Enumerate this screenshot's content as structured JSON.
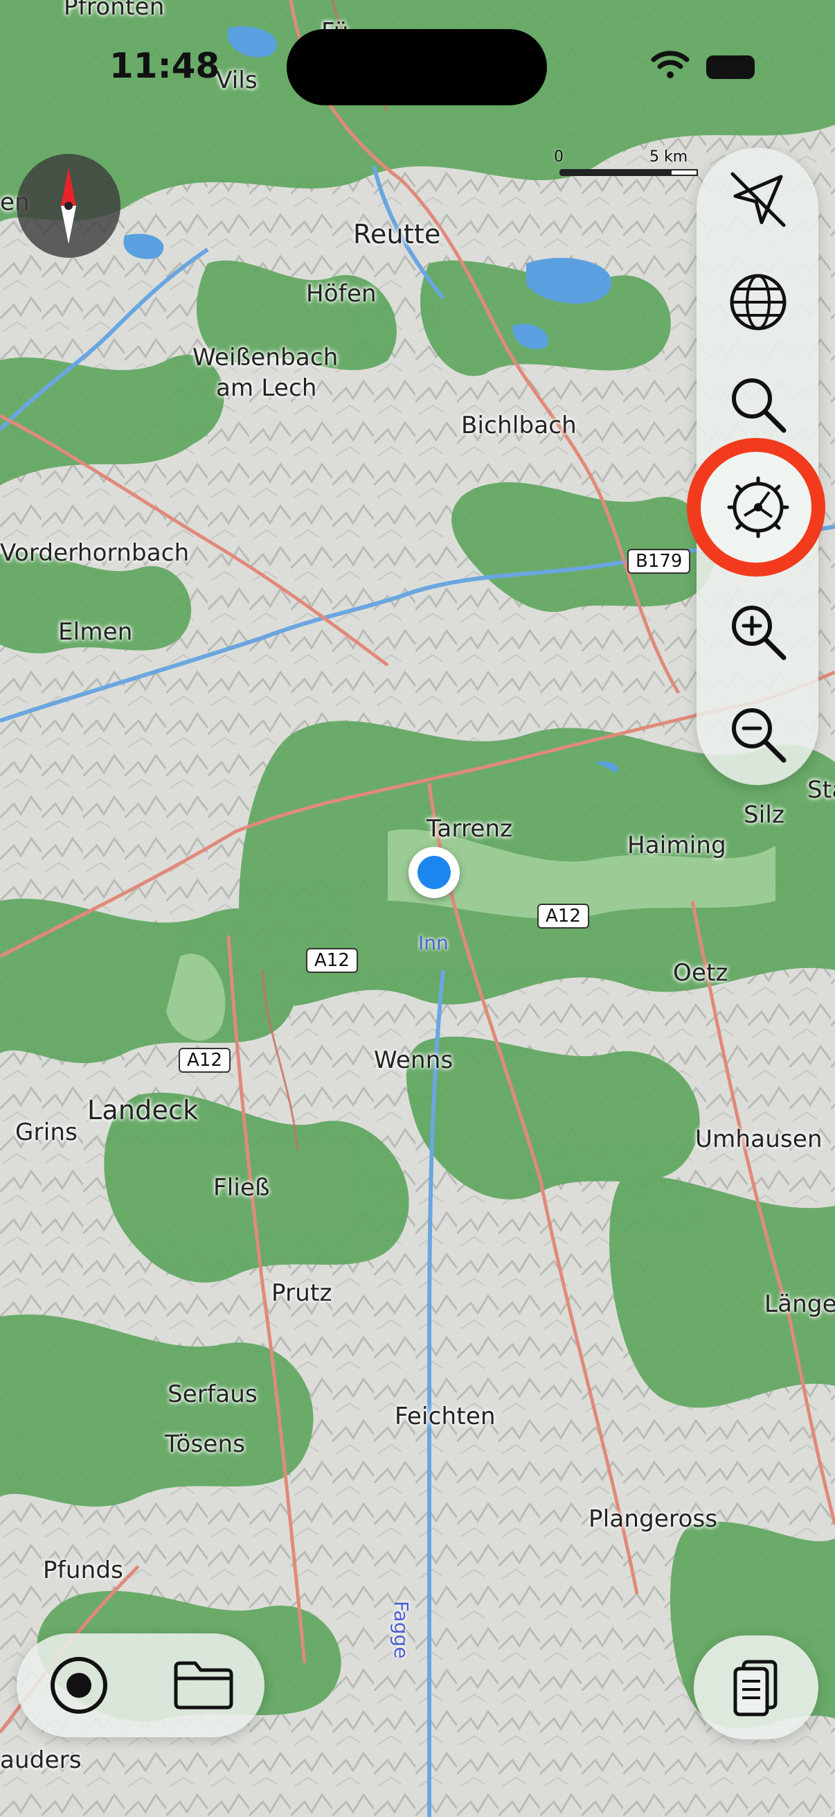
{
  "status_bar": {
    "time": "11:48"
  },
  "scale": {
    "start": "0",
    "end": "5 km"
  },
  "toolbar": {
    "buttons": [
      {
        "icon": "location-arrow-icon"
      },
      {
        "icon": "globe-icon"
      },
      {
        "icon": "search-icon"
      },
      {
        "icon": "settings-dial-icon",
        "highlighted": true
      },
      {
        "icon": "zoom-in-icon"
      },
      {
        "icon": "zoom-out-icon"
      }
    ],
    "highlight_color": "#f23a1d"
  },
  "bottom_left": {
    "buttons": [
      {
        "icon": "record-icon"
      },
      {
        "icon": "folder-icon"
      }
    ]
  },
  "bottom_right": {
    "icon": "documents-icon"
  },
  "map": {
    "places": {
      "pfronten": "Pfronten",
      "vils": "Vils",
      "reutte": "Reutte",
      "hoefen": "Höfen",
      "weissenbach1": "Weißenbach",
      "weissenbach2": "am Lech",
      "bichlbach": "Bichlbach",
      "vorderhornbach": "Vorderhornbach",
      "elmen": "Elmen",
      "tarrenz": "Tarrenz",
      "haiming": "Haiming",
      "silz": "Silz",
      "sta": "Sta",
      "oetz": "Oetz",
      "wenns": "Wenns",
      "landeck": "Landeck",
      "grins": "Grins",
      "fliess": "Fließ",
      "umhausen": "Umhausen",
      "prutz": "Prutz",
      "laenge": "Länge",
      "serfaus": "Serfaus",
      "feichten": "Feichten",
      "toesens": "Tösens",
      "plangeross": "Plangeross",
      "pfunds": "Pfunds",
      "nauders": "auders",
      "en": "en",
      "fuessen": "Fü"
    },
    "water": {
      "inn": "Inn",
      "fagge": "Fagge"
    },
    "roads": {
      "a12_1": "A12",
      "a12_2": "A12",
      "a12_3": "A12",
      "b179": "B179"
    },
    "colors": {
      "forest": "#5fa65f",
      "rock": "#d9dad6",
      "road": "#e08a7a",
      "water": "#5aa0e0",
      "location": "#1c86ee"
    }
  }
}
